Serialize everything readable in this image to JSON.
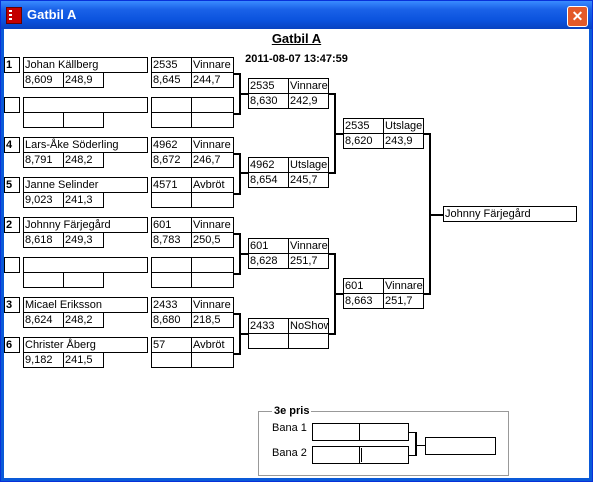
{
  "window": {
    "title": "Gatbil A",
    "close_icon": "close-icon"
  },
  "header": {
    "title": "Gatbil A",
    "datetime": "2011-08-07 13:47:59"
  },
  "round1": [
    {
      "seed": "1",
      "name": "Johan Källberg",
      "t1": "8,609",
      "t2": "248,9",
      "lane": "2535",
      "result": "Vinnare",
      "r1": "8,645",
      "r2": "244,7"
    },
    {
      "seed": "",
      "name": "",
      "t1": "",
      "t2": "",
      "lane": "",
      "result": "",
      "r1": "",
      "r2": ""
    },
    {
      "seed": "4",
      "name": "Lars-Åke Söderling",
      "t1": "8,791",
      "t2": "248,2",
      "lane": "4962",
      "result": "Vinnare",
      "r1": "8,672",
      "r2": "246,7"
    },
    {
      "seed": "5",
      "name": "Janne Selinder",
      "t1": "9,023",
      "t2": "241,3",
      "lane": "4571",
      "result": "Avbröt",
      "r1": "",
      "r2": ""
    },
    {
      "seed": "2",
      "name": "Johnny Färjegård",
      "t1": "8,618",
      "t2": "249,3",
      "lane": "601",
      "result": "Vinnare",
      "r1": "8,783",
      "r2": "250,5"
    },
    {
      "seed": "",
      "name": "",
      "t1": "",
      "t2": "",
      "lane": "",
      "result": "",
      "r1": "",
      "r2": ""
    },
    {
      "seed": "3",
      "name": "Micael Eriksson",
      "t1": "8,624",
      "t2": "248,2",
      "lane": "2433",
      "result": "Vinnare",
      "r1": "8,680",
      "r2": "218,5"
    },
    {
      "seed": "6",
      "name": "Christer Åberg",
      "t1": "9,182",
      "t2": "241,5",
      "lane": "57",
      "result": "Avbröt",
      "r1": "",
      "r2": ""
    }
  ],
  "round2": [
    {
      "lane": "2535",
      "result": "Vinnare",
      "r1": "8,630",
      "r2": "242,9"
    },
    {
      "lane": "4962",
      "result": "Utslagen",
      "r1": "8,654",
      "r2": "245,7"
    },
    {
      "lane": "601",
      "result": "Vinnare",
      "r1": "8,628",
      "r2": "251,7"
    },
    {
      "lane": "2433",
      "result": "NoShow",
      "r1": "",
      "r2": ""
    }
  ],
  "round3": [
    {
      "lane": "2535",
      "result": "Utslagen",
      "r1": "8,620",
      "r2": "243,9"
    },
    {
      "lane": "601",
      "result": "Vinnare",
      "r1": "8,663",
      "r2": "251,7"
    }
  ],
  "winner": "Johnny Färjegård",
  "third_prize": {
    "title": "3e pris",
    "lane1_label": "Bana 1",
    "lane2_label": "Bana 2"
  }
}
